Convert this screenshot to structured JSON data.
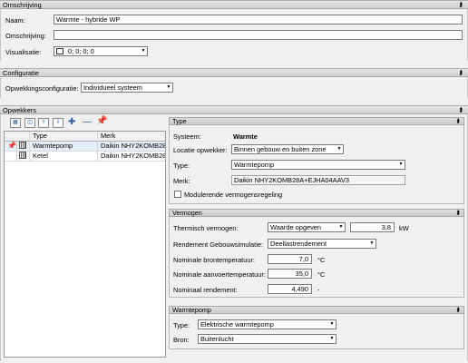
{
  "omschrijving_section": {
    "title": "Omschrijving",
    "naam_label": "Naam:",
    "naam_value": "Warmte - hybride WP",
    "omschrijving_label": "Omschrijving:",
    "omschrijving_value": "",
    "visualisatie_label": "Visualisatie:",
    "visualisatie_value": "0; 0; 0; 0"
  },
  "configuratie_section": {
    "title": "Configuratie",
    "opwekkingsconfiguratie_label": "Opwekkingsconfiguratie:",
    "opwekkingsconfiguratie_value": "Individueel systeem"
  },
  "opwekkers_section": {
    "title": "Opwekkers",
    "grid": {
      "columns": [
        "Type",
        "Merk"
      ],
      "rows": [
        {
          "type": "Warmtepomp",
          "merk": "Daikin NHY2KOMB28"
        },
        {
          "type": "Ketel",
          "merk": "Daikin NHY2KOMB28"
        }
      ]
    }
  },
  "type_panel": {
    "title": "Type",
    "systeem_label": "Systeem:",
    "systeem_value": "Warmte",
    "locatie_label": "Locatie opwekker:",
    "locatie_value": "Binnen gebouw en buiten zone",
    "type_label": "Type:",
    "type_value": "Warmtepomp",
    "merk_label": "Merk:",
    "merk_value": "Daikin NHY2KOMB28A+EJHA04AAV3",
    "modulerende_label": "Modulerende vermogensregeling"
  },
  "vermogen_panel": {
    "title": "Vermogen",
    "thermisch_label": "Thermisch vermogen:",
    "thermisch_select": "Waarde opgeven",
    "thermisch_value": "3,8",
    "thermisch_unit": "kW",
    "rendement_label": "Rendement Gebouwsimulatie:",
    "rendement_value": "Deellastrendement",
    "bron_temp_label": "Nominale brontemperatuur:",
    "bron_temp_value": "7,0",
    "bron_temp_unit": "°C",
    "aanvoer_label": "Nominale aanvoertemperatuur:",
    "aanvoer_value": "35,0",
    "aanvoer_unit": "°C",
    "nom_rend_label": "Nominaal rendement:",
    "nom_rend_value": "4,490",
    "nom_rend_unit": "-"
  },
  "warmtepomp_panel": {
    "title": "Warmtepomp",
    "type_label": "Type:",
    "type_value": "Elektrische warmtepomp",
    "bron_label": "Bron:",
    "bron_value": "Buitenlucht"
  },
  "icons": {
    "collapse": "double-chevron-up-icon",
    "dropdown": "chevron-down-icon"
  }
}
